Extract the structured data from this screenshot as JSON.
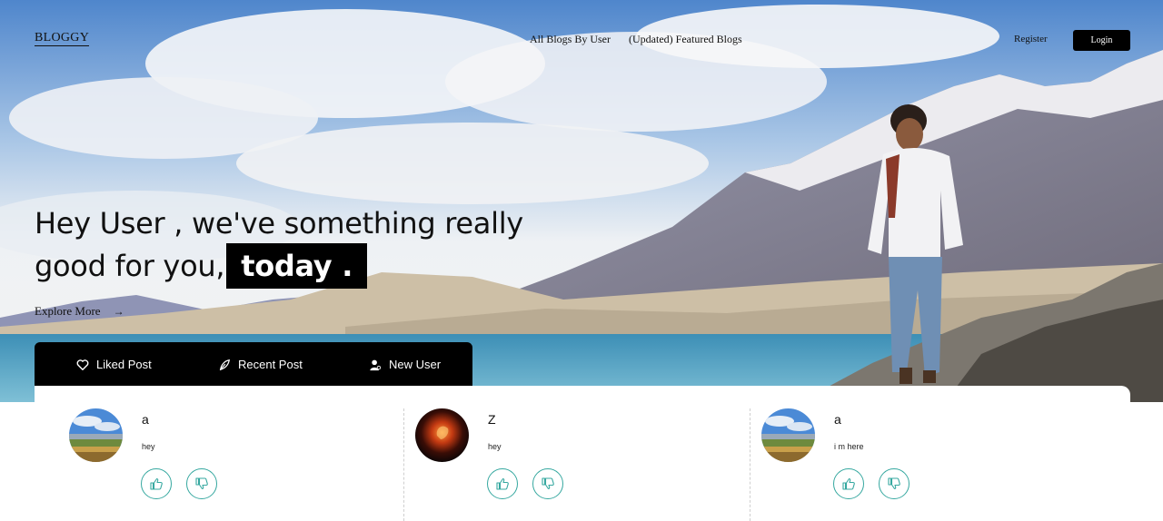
{
  "brand": "BLOGGY",
  "nav": {
    "links": [
      "All Blogs By User",
      "(Updated) Featured Blogs"
    ],
    "register": "Register",
    "login": "Login"
  },
  "hero": {
    "line1": "Hey User , we've something really",
    "line2": "good for you,",
    "highlight": "today .",
    "explore": "Explore More",
    "explore_arrow": "→"
  },
  "tabs": [
    {
      "label": "Liked Post",
      "icon": "heart-icon"
    },
    {
      "label": "Recent Post",
      "icon": "feather-icon"
    },
    {
      "label": "New User",
      "icon": "user-icon"
    }
  ],
  "posts": [
    {
      "title": "a",
      "body": "hey",
      "avatar": "landscape-avatar"
    },
    {
      "title": "Z",
      "body": "hey",
      "avatar": "fire-avatar"
    },
    {
      "title": "a",
      "body": "i m here",
      "avatar": "landscape-avatar"
    }
  ],
  "colors": {
    "accent": "#36a8a0",
    "dark": "#000000"
  }
}
